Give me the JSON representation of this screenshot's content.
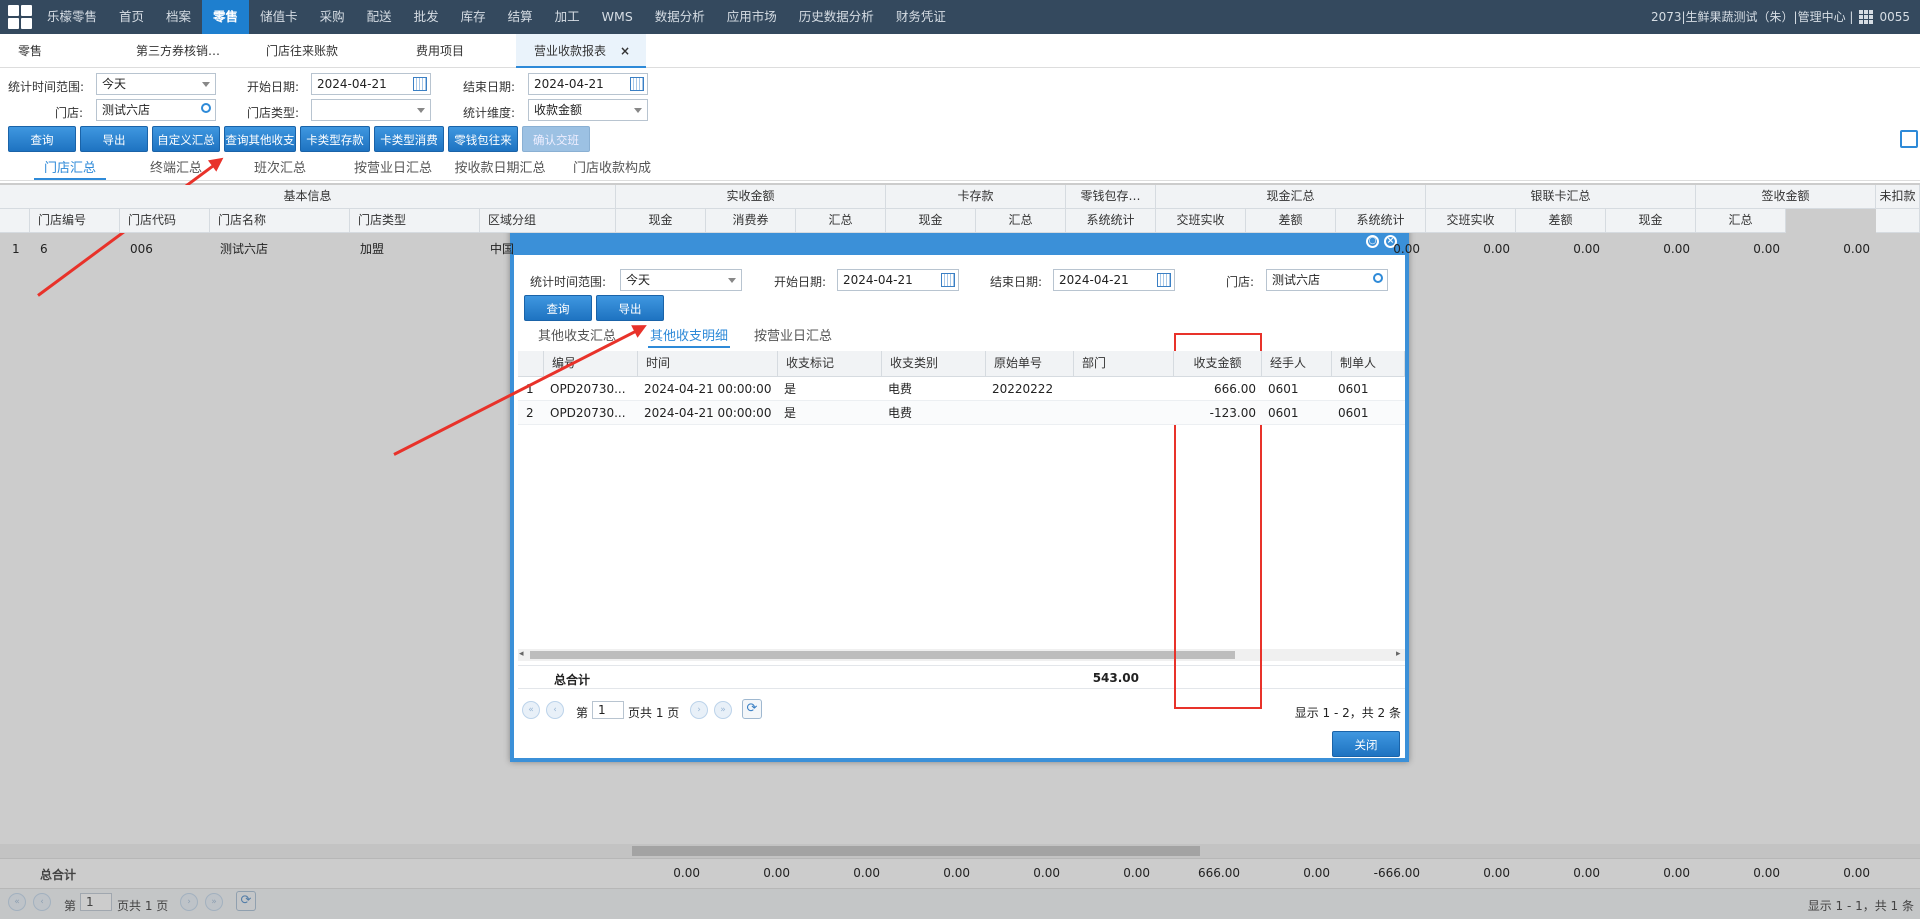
{
  "nav": {
    "items": [
      "乐檬零售",
      "首页",
      "档案",
      "零售",
      "储值卡",
      "采购",
      "配送",
      "批发",
      "库存",
      "结算",
      "加工",
      "WMS",
      "数据分析",
      "应用市场",
      "历史数据分析",
      "财务凭证"
    ],
    "active_index": 3,
    "right_text": "2073|生鲜果蔬测试（朱）|管理中心 |",
    "user": "0055"
  },
  "page_tabs": [
    {
      "label": "零售"
    },
    {
      "label": "第三方券核销…"
    },
    {
      "label": "门店往来账款"
    },
    {
      "label": "费用项目"
    },
    {
      "label": "营业收款报表",
      "close": "×"
    }
  ],
  "filters": {
    "range_label": "统计时间范围:",
    "range_value": "今天",
    "start_label": "开始日期:",
    "start_value": "2024-04-21",
    "end_label": "结束日期:",
    "end_value": "2024-04-21",
    "store_label": "门店:",
    "store_value": "测试六店",
    "store_type_label": "门店类型:",
    "store_type_value": "",
    "dimension_label": "统计维度:",
    "dimension_value": "收款金额"
  },
  "buttons": [
    "查询",
    "导出",
    "自定义汇总",
    "查询其他收支",
    "卡类型存款",
    "卡类型消费",
    "零钱包往来",
    "确认交班"
  ],
  "sub_tabs": [
    "门店汇总",
    "终端汇总",
    "班次汇总",
    "按营业日汇总",
    "按收款日期汇总",
    "门店收款构成"
  ],
  "grid": {
    "groups": [
      "基本信息",
      "实收金额",
      "卡存款",
      "零钱包存…",
      "现金汇总",
      "银联卡汇总",
      "签收金额",
      "未扣款"
    ],
    "columns": [
      "门店编号",
      "门店代码",
      "门店名称",
      "门店类型",
      "区域分组",
      "现金",
      "消费券",
      "汇总",
      "现金",
      "汇总",
      "系统统计",
      "交班实收",
      "差额",
      "系统统计",
      "交班实收",
      "差额",
      "现金",
      "汇总"
    ],
    "row": {
      "idx": "1",
      "store_no": "6",
      "store_code": "006",
      "store_name": "测试六店",
      "store_type": "加盟",
      "area": "中国",
      "vals": [
        "0.00",
        "0.00",
        "0.00",
        "0.00",
        "0.00",
        "0.00"
      ]
    },
    "totals_label": "总合计",
    "totals": [
      "0.00",
      "0.00",
      "0.00",
      "0.00",
      "0.00",
      "0.00",
      "666.00",
      "0.00",
      "-666.00",
      "0.00",
      "0.00",
      "0.00",
      "0.00",
      "0.00"
    ]
  },
  "pager": {
    "page_prefix": "第",
    "page_value": "1",
    "page_suffix": "页共 1 页",
    "summary": "显示 1 - 1，共 1 条"
  },
  "modal": {
    "filters": {
      "range_label": "统计时间范围:",
      "range_value": "今天",
      "start_label": "开始日期:",
      "start_value": "2024-04-21",
      "end_label": "结束日期:",
      "end_value": "2024-04-21",
      "store_label": "门店:",
      "store_value": "测试六店"
    },
    "buttons": [
      "查询",
      "导出"
    ],
    "tabs": [
      "其他收支汇总",
      "其他收支明细",
      "按营业日汇总"
    ],
    "active_tab": 1,
    "columns": [
      "编号",
      "时间",
      "收支标记",
      "收支类别",
      "原始单号",
      "部门",
      "收支金额",
      "经手人",
      "制单人"
    ],
    "rows": [
      {
        "idx": "1",
        "no": "OPD20730...",
        "time": "2024-04-21 00:00:00",
        "mark": "是",
        "category": "电费",
        "origin": "20220222",
        "dept": "",
        "amount": "666.00",
        "handler": "0601",
        "maker": "0601"
      },
      {
        "idx": "2",
        "no": "OPD20730...",
        "time": "2024-04-21 00:00:00",
        "mark": "是",
        "category": "电费",
        "origin": "",
        "dept": "",
        "amount": "-123.00",
        "handler": "0601",
        "maker": "0601"
      }
    ],
    "total_label": "总合计",
    "total_amount": "543.00",
    "pager": {
      "page_prefix": "第",
      "page_value": "1",
      "page_suffix": "页共 1 页",
      "summary": "显示 1 - 2，共 2 条"
    },
    "close_label": "关闭"
  },
  "colors": {
    "nav_bg": "#34495e",
    "nav_active": "#1e7fcf",
    "button": "#2a84d2",
    "highlight": "#e8322a"
  }
}
